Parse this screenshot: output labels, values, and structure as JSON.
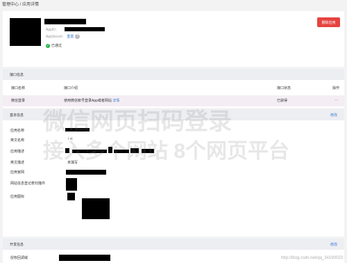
{
  "breadcrumb": "管理中心 / 应用详情",
  "app": {
    "appid_label": "AppID：",
    "secret_label": "AppSecret：",
    "reset_label": "重置",
    "approved_label": "已通过",
    "delete_label": "删除应用"
  },
  "api": {
    "section_title": "接口信息",
    "columns": [
      "接口名称",
      "接口介绍",
      "接口状态",
      "操作"
    ],
    "row": {
      "name": "微信登录",
      "desc": "使用微信帐号登录App或者网站",
      "detail": "详情",
      "status": "已获得",
      "op": "···"
    }
  },
  "basic": {
    "section_title": "基本信息",
    "edit_label": "修改",
    "fields": [
      {
        "label": "应用名称"
      },
      {
        "label": "英文名称",
        "value": "t xt"
      },
      {
        "label": "应用描述"
      },
      {
        "label": "英文描述",
        "value": "未填写"
      },
      {
        "label": "应用官网"
      },
      {
        "label": "网站信息登记表扫描件"
      },
      {
        "label": "应用图标"
      }
    ]
  },
  "dev": {
    "section_title": "开发信息",
    "edit_label": "修改",
    "field_label": "授权回调域"
  },
  "watermark": {
    "line1": "微信网页扫码登录",
    "line2": "接入多个网站 8个网页平台",
    "url": "http://blog.csdn.net/qq_34190023"
  },
  "colors": {
    "danger": "#e64340",
    "link": "#3a7bd5",
    "success": "#2bb24c"
  }
}
